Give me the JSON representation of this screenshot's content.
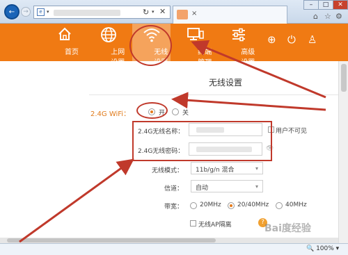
{
  "browser": {
    "back_icon": "←",
    "forward_icon": "→",
    "refresh_icon": "↻",
    "stop_icon": "✕",
    "tab_close": "×",
    "zoom": "100%"
  },
  "router_nav": {
    "items": [
      {
        "label": "首页",
        "icon": "home-icon"
      },
      {
        "label": "上网设置",
        "icon": "globe-icon"
      },
      {
        "label": "无线设置",
        "icon": "wifi-icon"
      },
      {
        "label": "终端管理",
        "icon": "monitor-icon"
      },
      {
        "label": "高级设置",
        "icon": "sliders-icon"
      }
    ]
  },
  "wireless": {
    "title": "无线设置",
    "wifi_label": "2.4G WiFi：",
    "wifi_on": "开",
    "wifi_off": "关",
    "ssid_label": "2.4G无线名称：",
    "hide_ssid_label": "用户不可见",
    "password_label": "2.4G无线密码：",
    "mode_label": "无线模式：",
    "mode_value": "11b/g/n 混合",
    "channel_label": "信道：",
    "channel_value": "自动",
    "bandwidth_label": "带宽：",
    "bandwidth_options": [
      "20MHz",
      "20/40MHz",
      "40MHz"
    ],
    "ap_isolation_label": "无线AP隔离",
    "help_icon": "?"
  },
  "watermark": "Bai度经验",
  "colors": {
    "accent": "#f07a13",
    "annotation": "#c0392b"
  }
}
